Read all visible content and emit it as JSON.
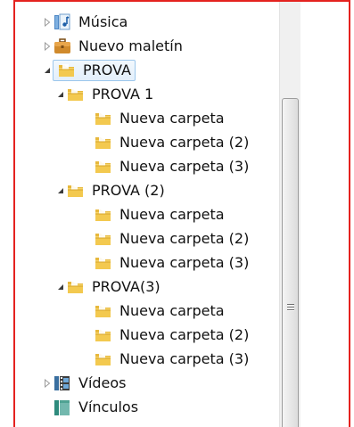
{
  "tree": {
    "items": [
      {
        "label": "Música",
        "icon": "music-library-icon",
        "arrow": "collapsed",
        "level": 0
      },
      {
        "label": "Nuevo maletín",
        "icon": "briefcase-icon",
        "arrow": "collapsed",
        "level": 0
      },
      {
        "label": "PROVA",
        "icon": "folder-icon",
        "arrow": "expanded",
        "level": 0,
        "selected": true
      },
      {
        "label": "PROVA 1",
        "icon": "folder-icon",
        "arrow": "expanded",
        "level": 1
      },
      {
        "label": "Nueva carpeta",
        "icon": "folder-icon",
        "arrow": "none",
        "level": 2
      },
      {
        "label": "Nueva carpeta (2)",
        "icon": "folder-icon",
        "arrow": "none",
        "level": 2
      },
      {
        "label": "Nueva carpeta (3)",
        "icon": "folder-icon",
        "arrow": "none",
        "level": 2
      },
      {
        "label": "PROVA (2)",
        "icon": "folder-icon",
        "arrow": "expanded",
        "level": 1
      },
      {
        "label": "Nueva carpeta",
        "icon": "folder-icon",
        "arrow": "none",
        "level": 2
      },
      {
        "label": "Nueva carpeta (2)",
        "icon": "folder-icon",
        "arrow": "none",
        "level": 2
      },
      {
        "label": "Nueva carpeta (3)",
        "icon": "folder-icon",
        "arrow": "none",
        "level": 2
      },
      {
        "label": "PROVA(3)",
        "icon": "folder-icon",
        "arrow": "expanded",
        "level": 1
      },
      {
        "label": "Nueva carpeta",
        "icon": "folder-icon",
        "arrow": "none",
        "level": 2
      },
      {
        "label": "Nueva carpeta (2)",
        "icon": "folder-icon",
        "arrow": "none",
        "level": 2
      },
      {
        "label": "Nueva carpeta (3)",
        "icon": "folder-icon",
        "arrow": "none",
        "level": 2
      },
      {
        "label": "Vídeos",
        "icon": "video-library-icon",
        "arrow": "collapsed",
        "level": 0
      },
      {
        "label": "Vínculos",
        "icon": "links-icon",
        "arrow": "none",
        "level": 0
      }
    ]
  },
  "colors": {
    "frame_border": "#e4221f",
    "selection_border": "#9cc7ec",
    "folder_yellow": "#f3cf5b"
  }
}
